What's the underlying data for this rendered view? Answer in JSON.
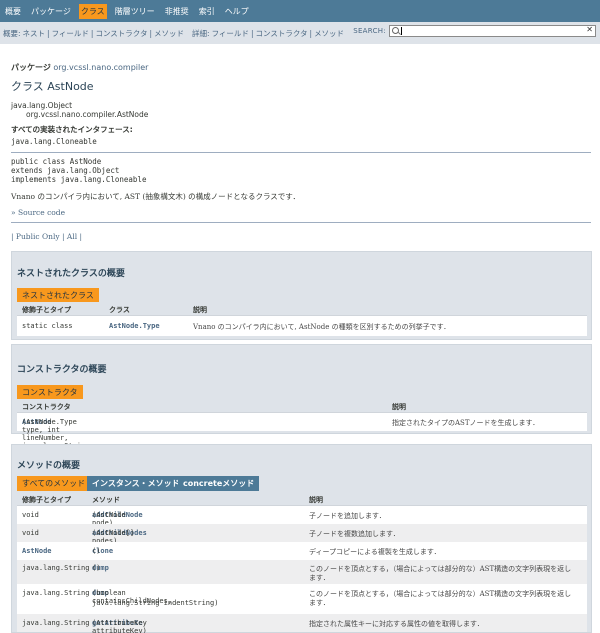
{
  "topnav": {
    "items": [
      "概要",
      "パッケージ",
      "クラス",
      "階層ツリー",
      "非推奨",
      "索引",
      "ヘルプ"
    ],
    "active_index": 2
  },
  "subnav": {
    "summary_label": "概要:",
    "summary_links": [
      "ネスト",
      "フィールド",
      "コンストラクタ",
      "メソッド"
    ],
    "detail_label": "詳細:",
    "detail_links": [
      "フィールド",
      "コンストラクタ",
      "メソッド"
    ],
    "search_label": "SEARCH:",
    "search_value": "",
    "reset_symbol": "✕"
  },
  "header": {
    "package_label": "パッケージ",
    "package_name": "org.vcssl.nano.compiler",
    "class_title": "クラス AstNode"
  },
  "inheritance": {
    "parent": "java.lang.Object",
    "child": "org.vcssl.nano.compiler.AstNode"
  },
  "interfaces": {
    "label": "すべての実装されたインタフェース:",
    "value": "java.lang.Cloneable"
  },
  "declaration": {
    "line1": "public class AstNode",
    "line2": "extends java.lang.Object",
    "line3": "implements java.lang.Cloneable"
  },
  "description": "Vnano のコンパイラ内において, AST (抽象構文木) の構成ノードとなるクラスです．",
  "source_link": "» Source code",
  "filter": {
    "prefix": "| ",
    "public_only": "Public Only",
    "mid": " | ",
    "all": "All",
    "suffix": " |"
  },
  "nested": {
    "title": "ネストされたクラスの概要",
    "tab": "ネストされたクラス",
    "headers": [
      "修飾子とタイプ",
      "クラス",
      "説明"
    ],
    "rows": [
      {
        "modifier": "static class",
        "name": "AstNode.Type",
        "desc": "Vnano のコンパイラ内において, AstNode の種類を区別するための列挙子です．"
      }
    ]
  },
  "constructors": {
    "title": "コンストラクタの概要",
    "tab": "コンストラクタ",
    "headers": [
      "コンストラクタ",
      "説明"
    ],
    "rows": [
      {
        "name": "AstNode",
        "params": "(AstNode.Type type, int lineNumber, java.lang.String fileName)",
        "desc": "指定されたタイプのASTノードを生成します．"
      }
    ]
  },
  "methods": {
    "title": "メソッドの概要",
    "tabs": [
      "すべてのメソッド",
      "インスタンス・メソッド",
      "concreteメソッド"
    ],
    "headers": [
      "修飾子とタイプ",
      "メソッド",
      "説明"
    ],
    "rows": [
      {
        "modifier": "void",
        "name": "addChildNode",
        "params": "(AstNode node)",
        "params2": "",
        "desc": "子ノードを追加します．",
        "desc2": ""
      },
      {
        "modifier": "void",
        "name": "addChildNodes",
        "params": "(AstNode[] nodes)",
        "params2": "",
        "desc": "子ノードを複数追加します．",
        "desc2": ""
      },
      {
        "modifier": "AstNode",
        "name": "clone",
        "params": "()",
        "params2": "",
        "desc": "ディープコピーによる複製を生成します．",
        "desc2": ""
      },
      {
        "modifier": "java.lang.String",
        "name": "dump",
        "params": "()",
        "params2": "",
        "desc": "このノードを頂点とする，（場合によっては部分的な）AST構造の文字列表現を返し",
        "desc2": "ます．"
      },
      {
        "modifier": "java.lang.String",
        "name": "dump",
        "params": "(boolean containsChildNodes,",
        "params2": "java.lang.String indentString)",
        "desc": "このノードを頂点とする，（場合によっては部分的な）AST構造の文字列表現を返し",
        "desc2": "ます．"
      },
      {
        "modifier": "java.lang.String",
        "name": "getAttribute",
        "params": "(AttributeKey attributeKey)",
        "params2": "",
        "desc": "指定された属性キーに対応する属性の値を取得します．",
        "desc2": ""
      }
    ]
  },
  "colors": {
    "nav_bg": "#4D7A97",
    "subnav_bg": "#DEE3E9",
    "accent": "#F8981D",
    "link": "#4A6782"
  }
}
